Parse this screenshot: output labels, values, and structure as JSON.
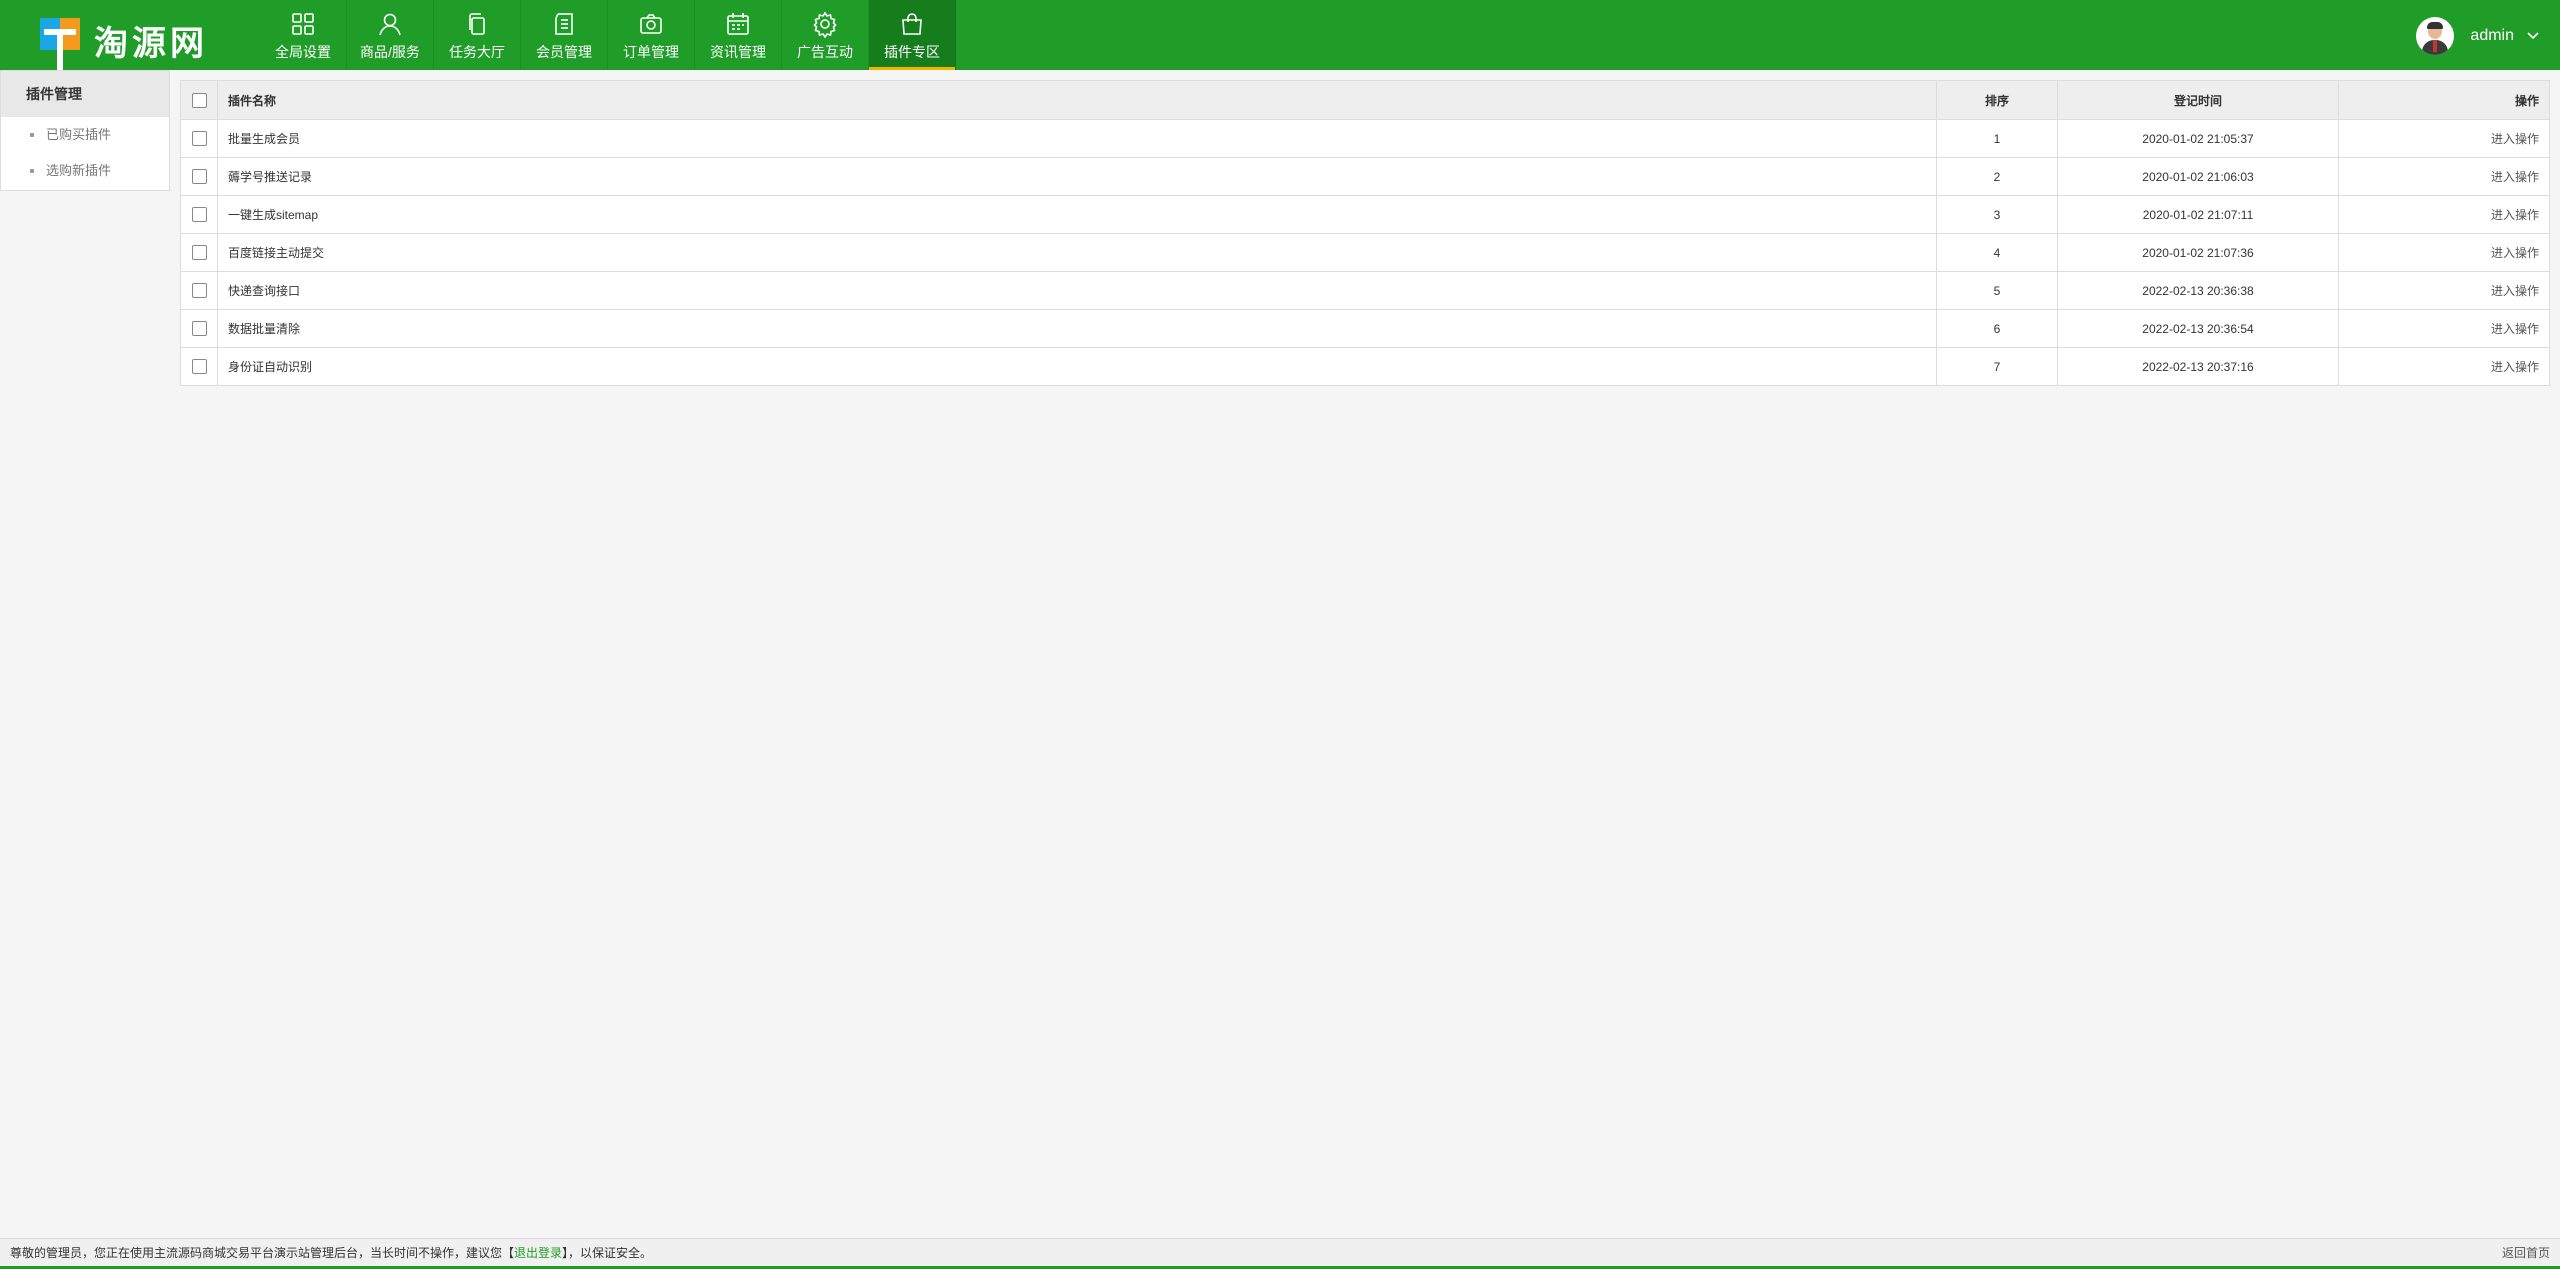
{
  "brand": {
    "name": "淘源网"
  },
  "nav": {
    "items": [
      {
        "label": "全局设置",
        "icon": "grid-icon"
      },
      {
        "label": "商品/服务",
        "icon": "user-icon"
      },
      {
        "label": "任务大厅",
        "icon": "copy-icon"
      },
      {
        "label": "会员管理",
        "icon": "document-icon"
      },
      {
        "label": "订单管理",
        "icon": "camera-icon"
      },
      {
        "label": "资讯管理",
        "icon": "calendar-icon"
      },
      {
        "label": "广告互动",
        "icon": "gear-icon"
      },
      {
        "label": "插件专区",
        "icon": "shopping-bag-icon",
        "active": true
      }
    ]
  },
  "user": {
    "name": "admin"
  },
  "sidebar": {
    "title": "插件管理",
    "items": [
      {
        "label": "已购买插件"
      },
      {
        "label": "选购新插件"
      }
    ]
  },
  "table": {
    "columns": {
      "name": "插件名称",
      "sort": "排序",
      "time": "登记时间",
      "op": "操作"
    },
    "rows": [
      {
        "name": "批量生成会员",
        "sort": "1",
        "time": "2020-01-02 21:05:37",
        "op": "进入操作"
      },
      {
        "name": "薅学号推送记录",
        "sort": "2",
        "time": "2020-01-02 21:06:03",
        "op": "进入操作"
      },
      {
        "name": "一键生成sitemap",
        "sort": "3",
        "time": "2020-01-02 21:07:11",
        "op": "进入操作"
      },
      {
        "name": "百度链接主动提交",
        "sort": "4",
        "time": "2020-01-02 21:07:36",
        "op": "进入操作"
      },
      {
        "name": "快递查询接口",
        "sort": "5",
        "time": "2022-02-13 20:36:38",
        "op": "进入操作"
      },
      {
        "name": "数据批量清除",
        "sort": "6",
        "time": "2022-02-13 20:36:54",
        "op": "进入操作"
      },
      {
        "name": "身份证自动识别",
        "sort": "7",
        "time": "2022-02-13 20:37:16",
        "op": "进入操作"
      }
    ]
  },
  "footer": {
    "text_before": "尊敬的管理员，您正在使用主流源码商城交易平台演示站管理后台，当长时间不操作，建议您【",
    "logout_label": "退出登录",
    "text_after": "】，以保证安全。",
    "home_link": "返回首页"
  },
  "colors": {
    "primary": "#1f9d28",
    "nav_active": "#167d1d",
    "accent": "#f0b400"
  }
}
